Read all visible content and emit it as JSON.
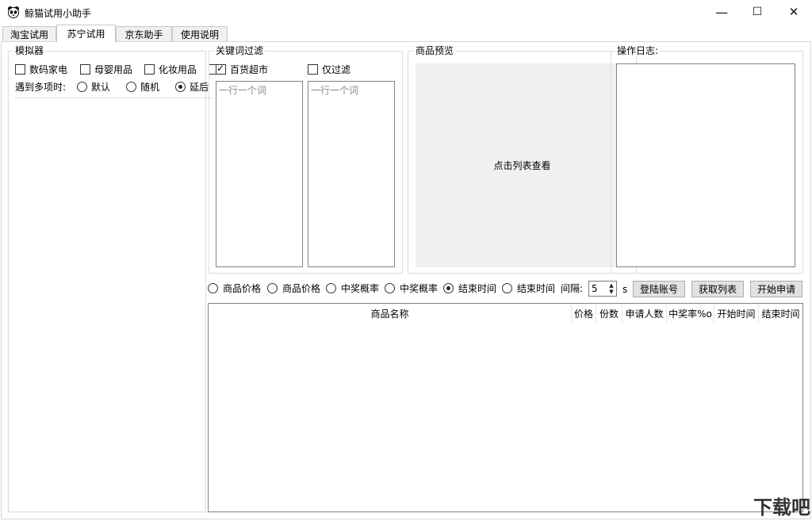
{
  "window": {
    "title": "鲸猫试用小助手",
    "minimize": "—",
    "maximize": "☐",
    "close": "✕"
  },
  "tabs": [
    {
      "label": "淘宝试用",
      "active": false
    },
    {
      "label": "苏宁试用",
      "active": true
    },
    {
      "label": "京东助手",
      "active": false
    },
    {
      "label": "使用说明",
      "active": false
    }
  ],
  "simulator": {
    "title": "模拟器",
    "categories": [
      {
        "label": "数码家电",
        "checked": false
      },
      {
        "label": "母婴用品",
        "checked": false
      },
      {
        "label": "化妆用品",
        "checked": false
      },
      {
        "label": "",
        "checked": false
      }
    ],
    "multi_label": "遇到多项时:",
    "multi_options": [
      {
        "label": "默认",
        "checked": false
      },
      {
        "label": "随机",
        "checked": false
      },
      {
        "label": "延后",
        "checked": true
      }
    ]
  },
  "keyword_filter": {
    "title": "关键词过滤",
    "left_check": {
      "label": "百货超市",
      "checked": true
    },
    "right_check": {
      "label": "仅过滤",
      "checked": false
    },
    "left_placeholder": "一行一个词",
    "right_placeholder": "一行一个词"
  },
  "preview": {
    "title": "商品预览",
    "hint": "点击列表查看"
  },
  "log": {
    "title": "操作日志:"
  },
  "sort": {
    "options": [
      {
        "label": "商品价格",
        "checked": false
      },
      {
        "label": "商品价格",
        "checked": false
      },
      {
        "label": "中奖概率",
        "checked": false
      },
      {
        "label": "中奖概率",
        "checked": false
      },
      {
        "label": "结束时间",
        "checked": true
      },
      {
        "label": "结束时间",
        "checked": false
      }
    ],
    "interval_label": "间隔:",
    "interval_value": "5",
    "interval_unit": "s"
  },
  "buttons": {
    "login": "登陆账号",
    "fetch": "获取列表",
    "start": "开始申请"
  },
  "table": {
    "columns": [
      "商品名称",
      "价格",
      "份数",
      "申请人数",
      "中奖率%o",
      "开始时间",
      "结束时间"
    ]
  },
  "watermark": "下载吧"
}
